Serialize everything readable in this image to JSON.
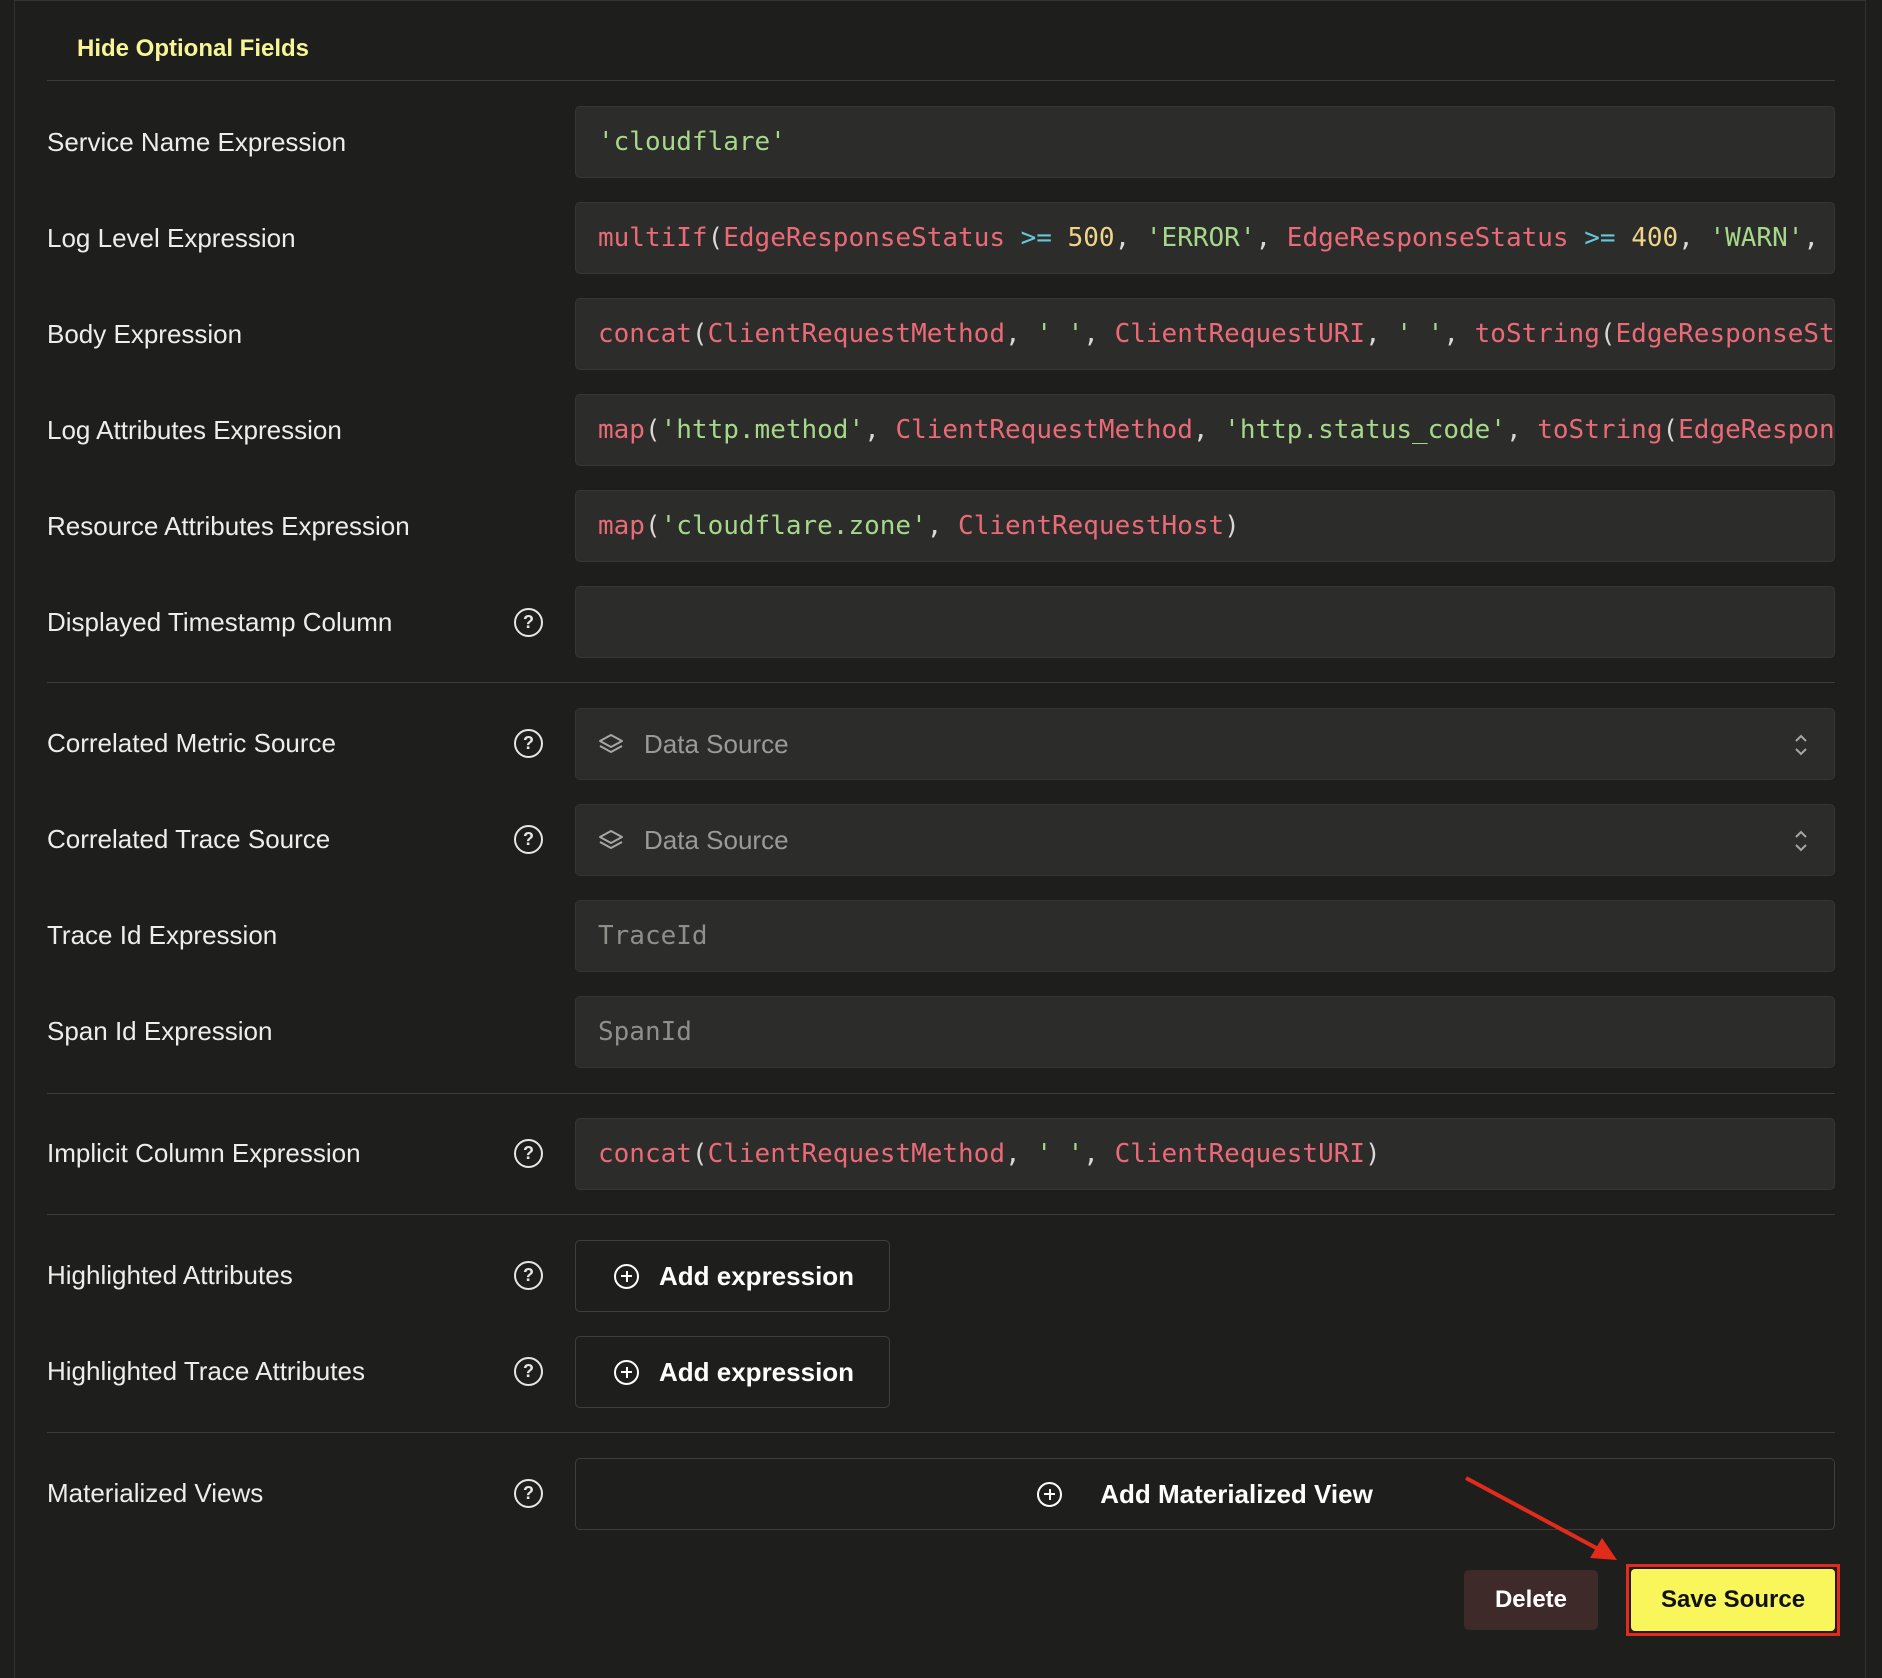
{
  "toggle_optional": "Hide Optional Fields",
  "fields": {
    "service_name": {
      "label": "Service Name Expression",
      "tokens": [
        [
          "str",
          "'cloudflare'"
        ]
      ]
    },
    "log_level": {
      "label": "Log Level Expression",
      "tokens": [
        [
          "fn",
          "multiIf"
        ],
        [
          "pun",
          "("
        ],
        [
          "col",
          "EdgeResponseStatus"
        ],
        [
          "pun",
          " "
        ],
        [
          "op",
          ">="
        ],
        [
          "pun",
          " "
        ],
        [
          "num",
          "500"
        ],
        [
          "pun",
          ", "
        ],
        [
          "str",
          "'ERROR'"
        ],
        [
          "pun",
          ", "
        ],
        [
          "col",
          "EdgeResponseStatus"
        ],
        [
          "pun",
          " "
        ],
        [
          "op",
          ">="
        ],
        [
          "pun",
          " "
        ],
        [
          "num",
          "400"
        ],
        [
          "pun",
          ", "
        ],
        [
          "str",
          "'WARN'"
        ],
        [
          "pun",
          ","
        ]
      ]
    },
    "body": {
      "label": "Body Expression",
      "tokens": [
        [
          "fn",
          "concat"
        ],
        [
          "pun",
          "("
        ],
        [
          "col",
          "ClientRequestMethod"
        ],
        [
          "pun",
          ", "
        ],
        [
          "str",
          "' '"
        ],
        [
          "pun",
          ", "
        ],
        [
          "col",
          "ClientRequestURI"
        ],
        [
          "pun",
          ", "
        ],
        [
          "str",
          "' '"
        ],
        [
          "pun",
          ", "
        ],
        [
          "fn",
          "toString"
        ],
        [
          "pun",
          "("
        ],
        [
          "col",
          "EdgeResponseSt"
        ]
      ]
    },
    "log_attributes": {
      "label": "Log Attributes Expression",
      "tokens": [
        [
          "fn",
          "map"
        ],
        [
          "pun",
          "("
        ],
        [
          "str",
          "'http.method'"
        ],
        [
          "pun",
          ", "
        ],
        [
          "col",
          "ClientRequestMethod"
        ],
        [
          "pun",
          ", "
        ],
        [
          "str",
          "'http.status_code'"
        ],
        [
          "pun",
          ", "
        ],
        [
          "fn",
          "toString"
        ],
        [
          "pun",
          "("
        ],
        [
          "col",
          "EdgeRespon"
        ]
      ]
    },
    "resource_attributes": {
      "label": "Resource Attributes Expression",
      "tokens": [
        [
          "fn",
          "map"
        ],
        [
          "pun",
          "("
        ],
        [
          "str",
          "'cloudflare.zone'"
        ],
        [
          "pun",
          ", "
        ],
        [
          "col",
          "ClientRequestHost"
        ],
        [
          "pun",
          ")"
        ]
      ]
    },
    "displayed_timestamp": {
      "label": "Displayed Timestamp Column",
      "value": ""
    },
    "correlated_metric": {
      "label": "Correlated Metric Source",
      "placeholder": "Data Source"
    },
    "correlated_trace": {
      "label": "Correlated Trace Source",
      "placeholder": "Data Source"
    },
    "trace_id": {
      "label": "Trace Id Expression",
      "placeholder": "TraceId"
    },
    "span_id": {
      "label": "Span Id Expression",
      "placeholder": "SpanId"
    },
    "implicit_column": {
      "label": "Implicit Column Expression",
      "tokens": [
        [
          "fn",
          "concat"
        ],
        [
          "pun",
          "("
        ],
        [
          "col",
          "ClientRequestMethod"
        ],
        [
          "pun",
          ", "
        ],
        [
          "str",
          "' '"
        ],
        [
          "pun",
          ", "
        ],
        [
          "col",
          "ClientRequestURI"
        ],
        [
          "pun",
          ")"
        ]
      ]
    },
    "highlighted_attributes": {
      "label": "Highlighted Attributes",
      "button": "Add expression"
    },
    "highlighted_trace_attributes": {
      "label": "Highlighted Trace Attributes",
      "button": "Add expression"
    },
    "materialized_views": {
      "label": "Materialized Views",
      "button": "Add Materialized View"
    }
  },
  "actions": {
    "delete": "Delete",
    "save": "Save Source"
  },
  "icons": {
    "help": "question-circle-icon",
    "data_source": "layers-icon",
    "select_chevron": "chevron-up-down-icon",
    "add": "plus-circle-icon"
  },
  "colors": {
    "accent_link": "#f7f596",
    "save_bg": "#f9f65c",
    "delete_bg": "#3e2a28",
    "annotation_red": "#e32b1b",
    "syntax_fn": "#ea6a78",
    "syntax_string": "#a5d88a",
    "syntax_number": "#f0d48a",
    "syntax_operator": "#67c7d8"
  }
}
